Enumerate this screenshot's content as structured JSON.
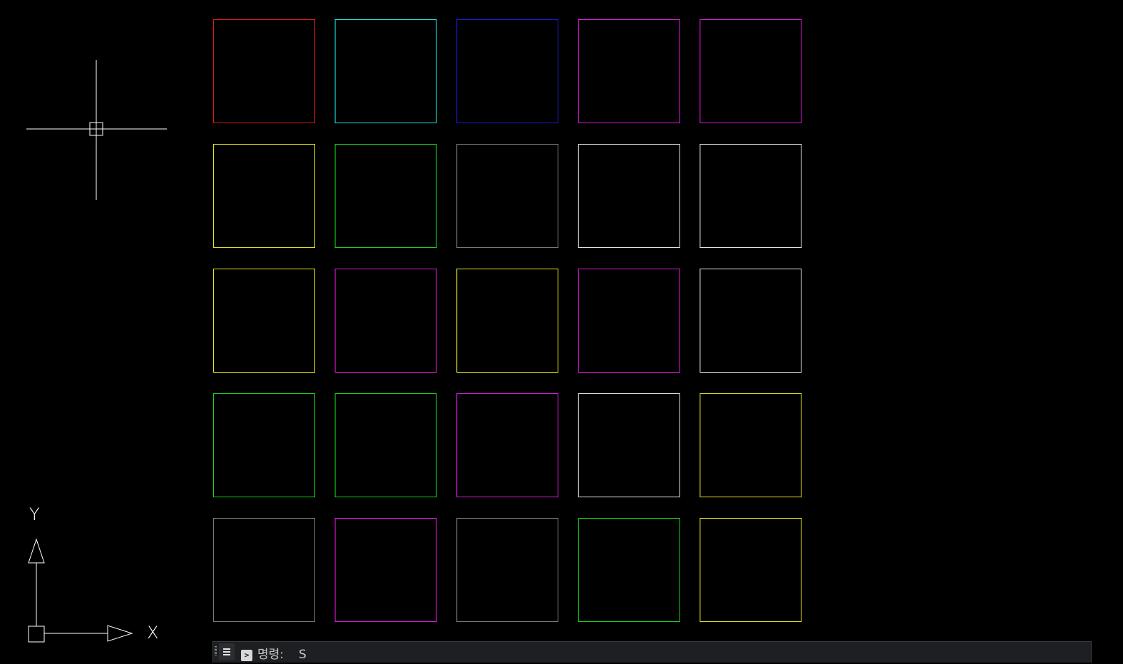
{
  "drawing": {
    "rectangle_grid": {
      "rows": 5,
      "cols": 5,
      "colors": [
        [
          "#e01c1c",
          "#19e6e6",
          "#1a1ad8",
          "#e01ce0",
          "#e01ce0"
        ],
        [
          "#e6e619",
          "#19d619",
          "#7a7a7a",
          "#e6e6e6",
          "#e6e6e6"
        ],
        [
          "#e6e619",
          "#e01ce0",
          "#e6e619",
          "#e01ce0",
          "#e6e6e6"
        ],
        [
          "#19d619",
          "#19d619",
          "#e01ce0",
          "#e6e6e6",
          "#e6e619"
        ],
        [
          "#7a7a7a",
          "#e01ce0",
          "#7a7a7a",
          "#19d619",
          "#e6e619"
        ]
      ]
    },
    "cursor": {
      "icon": "crosshair-pickbox-icon",
      "color": "#ffffff"
    },
    "ucs_icon": {
      "x_label": "X",
      "y_label": "Y",
      "color": "#ffffff"
    }
  },
  "command_line": {
    "menu_icon": "hamburger-menu-icon",
    "prompt_icon": "command-prompt-icon",
    "prompt_label": "명령:",
    "input_value": "S",
    "background": "#1e1f22"
  }
}
